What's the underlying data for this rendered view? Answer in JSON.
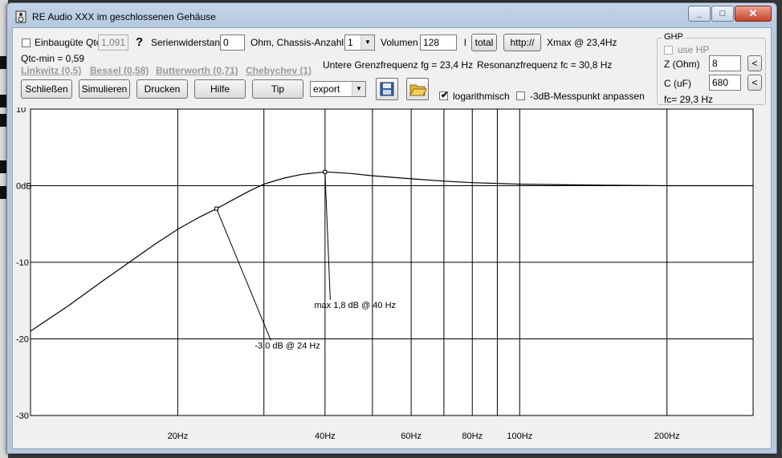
{
  "window": {
    "title": "RE Audio XXX im geschlossenen Gehäuse",
    "min": "_",
    "max": "□",
    "close": "✕"
  },
  "row1": {
    "einbau_label": "Einbaugüte Qtc",
    "qtc_value": "1,091",
    "help": "?",
    "serien_label": "Serienwiderstand",
    "serien_value": "0",
    "chassis_label": "Ohm, Chassis-Anzahl",
    "chassis_value": "1",
    "volumen_label": "Volumen",
    "volumen_value": "128",
    "unit_l": "l",
    "total_label": "total",
    "http_label": "http://",
    "xmax_text": "Xmax @ 23,4Hz"
  },
  "row2": {
    "qtcmin_text": "Qtc-min = 0,59",
    "links": [
      "Linkwitz (0,5)",
      "Bessel (0,58)",
      "Butterworth (0,71)",
      "Chebychev (1)"
    ],
    "fg_text": "Untere Grenzfrequenz fg = 23,4 Hz",
    "fc_text": "Resonanzfrequenz fc = 30,8 Hz"
  },
  "buttons": {
    "close": "Schließen",
    "simulate": "Simulieren",
    "print": "Drucken",
    "help": "Hilfe",
    "tip": "Tip",
    "export": "export"
  },
  "options": {
    "log_label": "logarithmisch",
    "log_checked": "✔",
    "db3_label": "-3dB-Messpunkt anpassen"
  },
  "ghp": {
    "caption": "GHP",
    "usehp_label": "use HP",
    "z_label": "Z (Ohm)",
    "z_value": "8",
    "c_label": "C (uF)",
    "c_value": "680",
    "fc_text": "fc= 29,3 Hz",
    "arrow": "<"
  },
  "chart_data": {
    "type": "line",
    "xscale": "log",
    "xlim": [
      10,
      300
    ],
    "ylim": [
      -30,
      10
    ],
    "y_ticks": [
      "10",
      "0dB",
      "-10",
      "-20",
      "-30"
    ],
    "x_ticks": [
      {
        "v": 20,
        "label": "20Hz"
      },
      {
        "v": 40,
        "label": "40Hz"
      },
      {
        "v": 60,
        "label": "60Hz"
      },
      {
        "v": 80,
        "label": "80Hz"
      },
      {
        "v": 100,
        "label": "100Hz"
      },
      {
        "v": 200,
        "label": "200Hz"
      }
    ],
    "x_grid": [
      20,
      30,
      40,
      50,
      60,
      70,
      80,
      90,
      100,
      200,
      300
    ],
    "series": [
      {
        "x": [
          10,
          12,
          14,
          16,
          18,
          20,
          22,
          24,
          26,
          28,
          30,
          33,
          36,
          40,
          45,
          50,
          60,
          70,
          80,
          100,
          130,
          160,
          200,
          250,
          300
        ],
        "y": [
          -19.0,
          -15.6,
          -12.5,
          -9.9,
          -7.6,
          -5.7,
          -4.2,
          -3.0,
          -1.8,
          -0.7,
          0.2,
          1.0,
          1.5,
          1.8,
          1.6,
          1.3,
          0.9,
          0.6,
          0.4,
          0.2,
          0.1,
          0.05,
          0.0,
          0.0,
          0.0
        ]
      }
    ],
    "annotations": [
      {
        "x": 24,
        "y": -3.0,
        "text": "-3,0 dB @ 24 Hz",
        "label_x": 31,
        "label_y": -20.2
      },
      {
        "x": 40,
        "y": 1.8,
        "text": "max 1,8 dB @ 40 Hz",
        "label_x": 41,
        "label_y": -14.9
      }
    ]
  }
}
